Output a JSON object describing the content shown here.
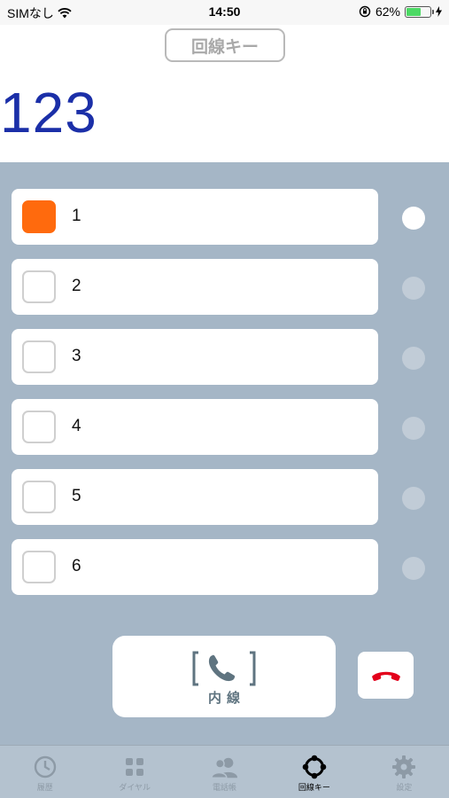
{
  "status_bar": {
    "carrier": "SIMなし",
    "time": "14:50",
    "battery_percent": "62%",
    "battery_level": 0.62
  },
  "header": {
    "title": "回線キー",
    "number": "123"
  },
  "lines": [
    {
      "label": "1",
      "active": true
    },
    {
      "label": "2",
      "active": false
    },
    {
      "label": "3",
      "active": false
    },
    {
      "label": "4",
      "active": false
    },
    {
      "label": "5",
      "active": false
    },
    {
      "label": "6",
      "active": false
    }
  ],
  "controls": {
    "naisen_label": "内線",
    "hangup_icon": "phone-hangup-icon"
  },
  "tabs": [
    {
      "label": "履歴",
      "icon": "clock-icon",
      "active": false
    },
    {
      "label": "ダイヤル",
      "icon": "dialpad-icon",
      "active": false
    },
    {
      "label": "電話帳",
      "icon": "contacts-icon",
      "active": false
    },
    {
      "label": "回線キー",
      "icon": "line-key-icon",
      "active": true
    },
    {
      "label": "設定",
      "icon": "gear-icon",
      "active": false
    }
  ],
  "colors": {
    "accent_orange": "#ff6a0d",
    "number_blue": "#1b2fa8",
    "background": "#a5b6c6",
    "hangup_red": "#e3001b"
  }
}
